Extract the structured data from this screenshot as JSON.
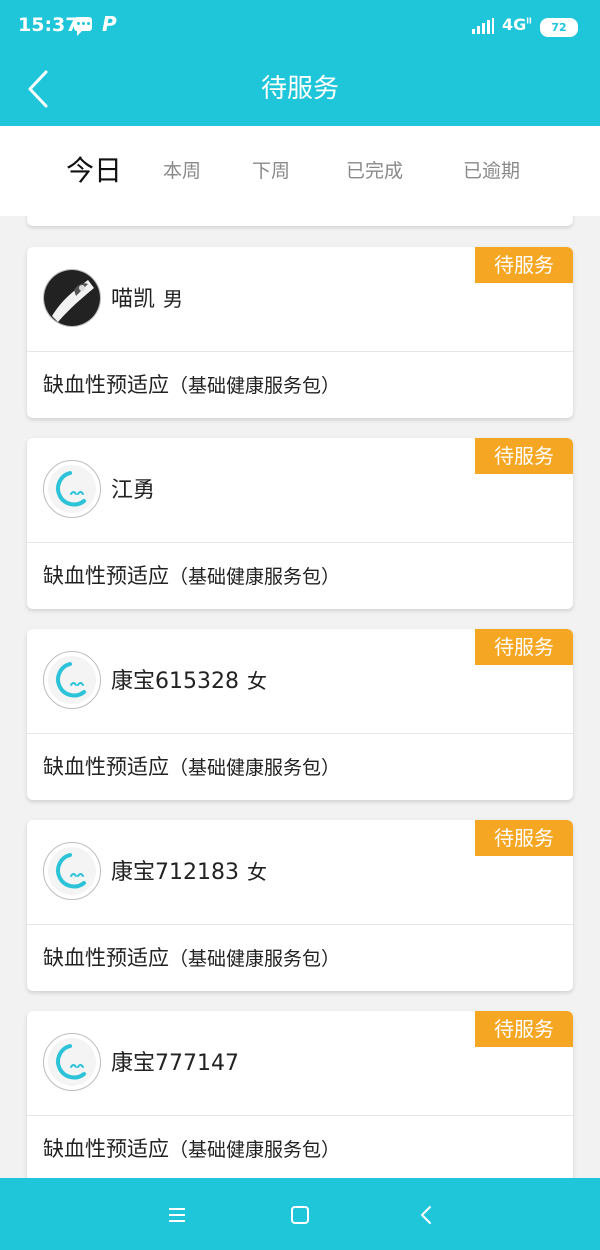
{
  "status_bar": {
    "time": "15:37",
    "network": "4G",
    "network_sup": "ll",
    "battery": "72"
  },
  "app_bar": {
    "title": "待服务",
    "back_icon": "chevron-left-icon"
  },
  "tabs": [
    {
      "label": "今日",
      "active": true
    },
    {
      "label": "本周",
      "active": false
    },
    {
      "label": "下周",
      "active": false
    },
    {
      "label": "已完成",
      "active": false
    },
    {
      "label": "已逾期",
      "active": false
    }
  ],
  "cards": [
    {
      "status": "待服务",
      "name": "喵凯",
      "gender": "男",
      "service": "缺血性预适应",
      "package": "（基础健康服务包）",
      "avatar": "photo"
    },
    {
      "status": "待服务",
      "name": "江勇",
      "gender": "",
      "service": "缺血性预适应",
      "package": "（基础健康服务包）",
      "avatar": "default"
    },
    {
      "status": "待服务",
      "name": "康宝615328",
      "gender": "女",
      "service": "缺血性预适应",
      "package": "（基础健康服务包）",
      "avatar": "default"
    },
    {
      "status": "待服务",
      "name": "康宝712183",
      "gender": "女",
      "service": "缺血性预适应",
      "package": "（基础健康服务包）",
      "avatar": "default"
    },
    {
      "status": "待服务",
      "name": "康宝777147",
      "gender": "",
      "service": "缺血性预适应",
      "package": "（基础健康服务包）",
      "avatar": "default"
    }
  ],
  "colors": {
    "primary": "#1fc6d9",
    "badge": "#f5a623",
    "background": "#f2f2f2"
  },
  "nav_bar": {
    "menu_icon": "menu-icon",
    "home_icon": "home-square-icon",
    "back_icon": "back-triangle-icon"
  }
}
